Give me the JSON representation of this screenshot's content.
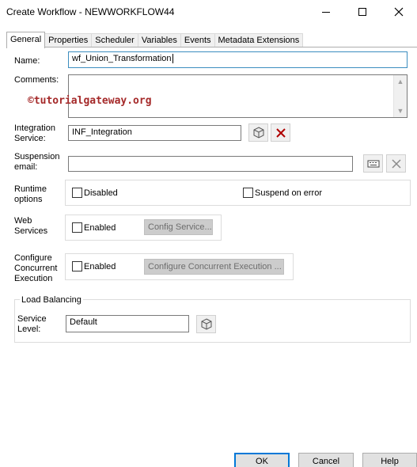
{
  "window": {
    "title": "Create Workflow - NEWWORKFLOW44"
  },
  "tabs": [
    {
      "label": "General"
    },
    {
      "label": "Properties"
    },
    {
      "label": "Scheduler"
    },
    {
      "label": "Variables"
    },
    {
      "label": "Events"
    },
    {
      "label": "Metadata Extensions"
    }
  ],
  "general": {
    "name_label": "Name:",
    "name_value": "wf_Union_Transformation",
    "comments_label": "Comments:",
    "comments_value": "",
    "watermark": "©tutorialgateway.org",
    "integration_label_1": "Integration",
    "integration_label_2": "Service:",
    "integration_value": "INF_Integration",
    "suspension_label_1": "Suspension",
    "suspension_label_2": "email:",
    "suspension_value": "",
    "runtime_label_1": "Runtime",
    "runtime_label_2": "options",
    "disabled_label": "Disabled",
    "disabled_checked": false,
    "suspend_on_error_label": "Suspend on error",
    "suspend_on_error_checked": false,
    "web_label_1": "Web",
    "web_label_2": "Services",
    "web_enabled_label": "Enabled",
    "web_enabled_checked": false,
    "config_service_label": "Config Service...",
    "concurrent_label_1": "Configure",
    "concurrent_label_2": "Concurrent",
    "concurrent_label_3": "Execution",
    "concurrent_enabled_label": "Enabled",
    "concurrent_enabled_checked": false,
    "configure_concurrent_label": "Configure Concurrent Execution ...",
    "load_balancing_legend": "Load Balancing",
    "service_level_label_1": "Service",
    "service_level_label_2": "Level:",
    "service_level_value": "Default"
  },
  "footer": {
    "ok_label": "OK",
    "cancel_label": "Cancel",
    "help_label": "Help"
  }
}
